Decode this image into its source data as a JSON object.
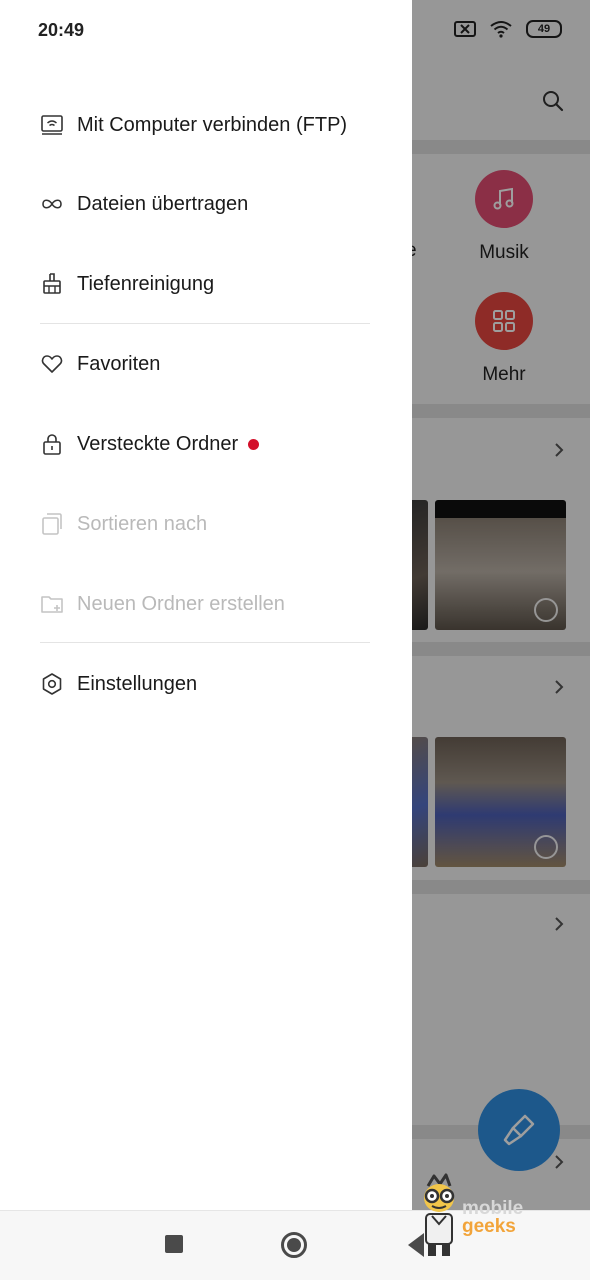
{
  "status_bar": {
    "time": "20:49",
    "battery": "49"
  },
  "drawer": {
    "items": [
      {
        "label": "Mit Computer verbinden (FTP)",
        "icon": "monitor-wifi-icon"
      },
      {
        "label": "Dateien übertragen",
        "icon": "infinity-icon"
      },
      {
        "label": "Tiefenreinigung",
        "icon": "broom-icon"
      },
      {
        "label": "Favoriten",
        "icon": "heart-icon"
      },
      {
        "label": "Versteckte Ordner",
        "icon": "lock-icon",
        "badge": "new-dot"
      },
      {
        "label": "Sortieren nach",
        "icon": "stack-icon",
        "disabled": true
      },
      {
        "label": "Neuen Ordner erstellen",
        "icon": "new-folder-icon",
        "disabled": true
      },
      {
        "label": "Einstellungen",
        "icon": "gear-icon"
      }
    ]
  },
  "background": {
    "categories": [
      {
        "label": "Musik",
        "icon": "music-note-icon",
        "color": "#e14c72"
      },
      {
        "label": "Mehr",
        "icon": "grid-icon",
        "color": "#e5463f"
      }
    ],
    "partial_category_letter": "e",
    "fab_icon": "clean-brush-icon",
    "fab_color": "#2f8fe0"
  },
  "watermark": {
    "line1": "mobile",
    "line2": "geeks"
  },
  "navbar": {
    "recents_icon": "square-icon",
    "home_icon": "circle-icon",
    "back_icon": "triangle-back-icon"
  },
  "colors": {
    "badge_dot": "#d3102a",
    "disabled_text": "#b9b9b9"
  }
}
